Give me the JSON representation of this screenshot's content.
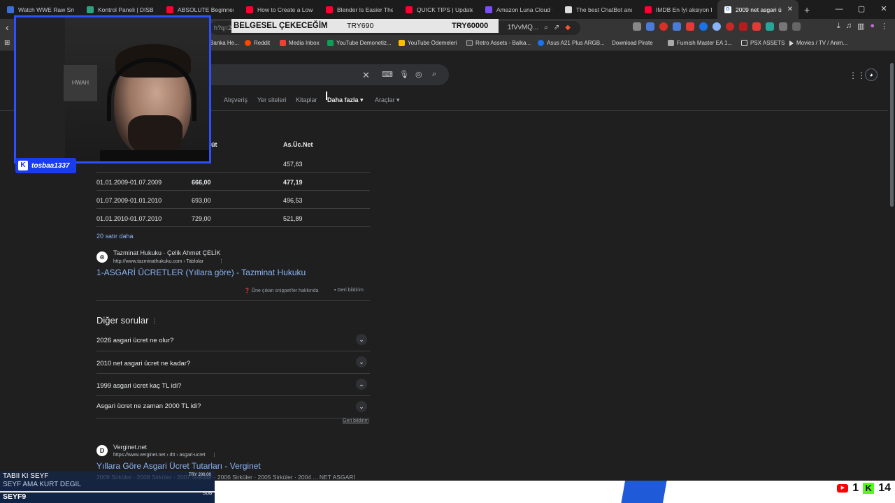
{
  "tabs": [
    {
      "title": "Watch WWE Raw Sma",
      "color": "#3b6fd8"
    },
    {
      "title": "Kontrol Paneli | DISBO",
      "color": "#2aa57b"
    },
    {
      "title": "ABSOLUTE Beginner B",
      "color": "#ff0033"
    },
    {
      "title": "How to Create a Low P",
      "color": "#ff0033"
    },
    {
      "title": "Blender Is Easier Then",
      "color": "#ff0033"
    },
    {
      "title": "QUICK TIPS | Update H",
      "color": "#ff0033"
    },
    {
      "title": "Amazon Luna Cloud G",
      "color": "#7b4dff"
    },
    {
      "title": "The best ChatBot and",
      "color": "#dddddd"
    },
    {
      "title": "IMDB En İyi aksiyon fil",
      "color": "#ff0033"
    }
  ],
  "active_tab": {
    "title": "2009 net asgari ü",
    "close": "✕"
  },
  "new_tab": "+",
  "window_controls": [
    "—",
    "▢",
    "✕"
  ],
  "toolbar": {
    "url_fragment": "h?q=2",
    "url_tail": "1fVvMQ..."
  },
  "donation_banner": {
    "goal_label": "BELGESEL ÇEKECEĞİM",
    "current": "TRY690",
    "target": "TRY60000"
  },
  "bookmarks": [
    {
      "label": "Banka He..."
    },
    {
      "label": "Reddit"
    },
    {
      "label": "Media Inbox"
    },
    {
      "label": "YouTube Demonetiz..."
    },
    {
      "label": "YouTube Ödemeleri"
    },
    {
      "label": "Retro Assets - Balka..."
    },
    {
      "label": "Asus A21 Plus ARGB..."
    },
    {
      "label": "Download Pirate"
    },
    {
      "label": "Furnish Master EA 1..."
    },
    {
      "label": "PSX ASSETS"
    },
    {
      "label": "Movies / TV / Anim..."
    }
  ],
  "search_filters": [
    "Alışveriş",
    "Yer siteleri",
    "Kitaplar",
    "Daha fazla",
    "Araçlar"
  ],
  "table": {
    "headers": [
      "Brüt",
      "As.Üc.Net"
    ],
    "header_partial": "üt",
    "rows": [
      {
        "period": "",
        "gross": "",
        "net": "457,63"
      },
      {
        "period": "01.01.2009-01.07.2009",
        "gross": "666,00",
        "net": "477,19"
      },
      {
        "period": "01.07.2009-01.01.2010",
        "gross": "693,00",
        "net": "496,53"
      },
      {
        "period": "01.01.2010-01.07.2010",
        "gross": "729,00",
        "net": "521,89"
      }
    ],
    "more_rows": "20 satır daha"
  },
  "result1": {
    "icon": "⊙",
    "site": "Tazminat Hukuku · Çelik Ahmet ÇELİK",
    "url": "http://www.tazminathukuku.com › Tablolar",
    "title": "1-ASGARİ ÜCRETLER (Yıllara göre) - Tazminat Hukuku",
    "snippet_about": "Öne çıkan snippet'ler hakkında",
    "feedback": "Geri bildirim"
  },
  "paa": {
    "title": "Diğer sorular",
    "questions": [
      "2026 asgari ücret ne olur?",
      "2010 net asgari ücret ne kadar?",
      "1999 asgari ücret kaç TL idi?",
      "Asgari ücret ne zaman 2000 TL idi?"
    ],
    "feedback": "Geri bildirim"
  },
  "result2": {
    "icon": "D",
    "site": "Verginet.net",
    "url": "https://www.verginet.net › dtt › asgari-ucret",
    "title": "Yıllara Göre Asgari Ücret Tutarları - Verginet",
    "snippet": "2009 Sirküler · 2008 Sirküler · 2007 Sirküler · 2006 Sirküler · 2005 Sirküler · 2004 ... NET ASGARİ"
  },
  "stream": {
    "username": "tosbaa1337",
    "ticker_line1": "TABII KI SEYF",
    "ticker_line2": "SEYF AMA KURT DEGIL",
    "ticker_line3": "SEYF9",
    "ticker_amount": "TRY 200.00",
    "ticker_sub": "SUB",
    "youtube_count": "1",
    "kick_count": "14",
    "poster_text": "HWAH"
  }
}
